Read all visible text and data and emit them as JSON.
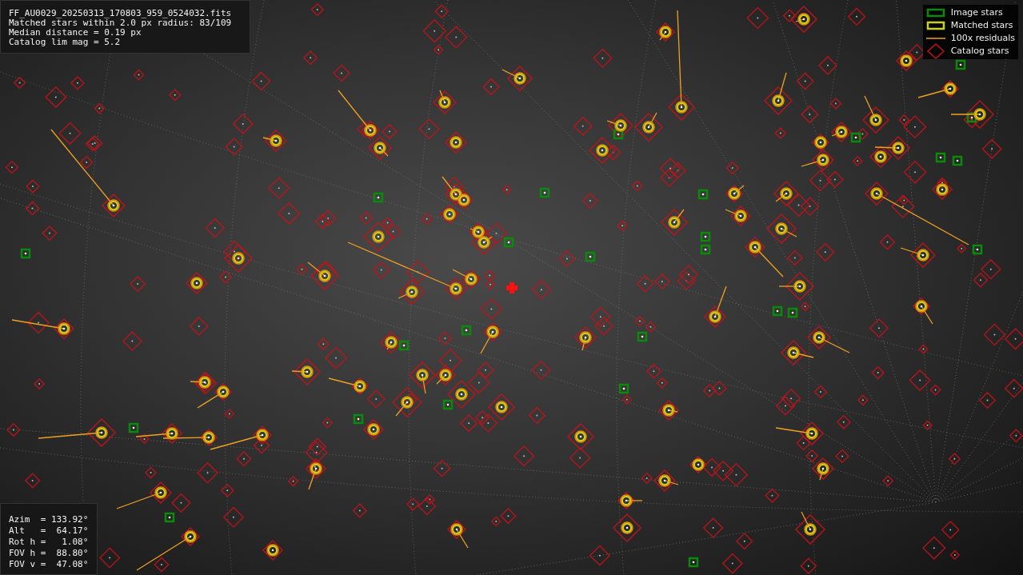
{
  "info_panel": {
    "lines": [
      "FF_AU0029_20250313_170803_959_0524032.fits",
      "Matched stars within 2.0 px radius: 83/109",
      "Median distance = 0.19 px",
      "Catalog lim mag = 5.2"
    ]
  },
  "legend": [
    {
      "kind": "image",
      "label": "Image stars"
    },
    {
      "kind": "matched",
      "label": "Matched stars"
    },
    {
      "kind": "residual",
      "label": "100x residuals"
    },
    {
      "kind": "catalog",
      "label": "Catalog stars"
    }
  ],
  "pointing_panel": {
    "lines": [
      "Azim  = 133.92°",
      "Alt   =  64.17°",
      "Rot h =   1.08°",
      "FOV h =  88.80°",
      "FOV v =  47.08°"
    ]
  }
}
